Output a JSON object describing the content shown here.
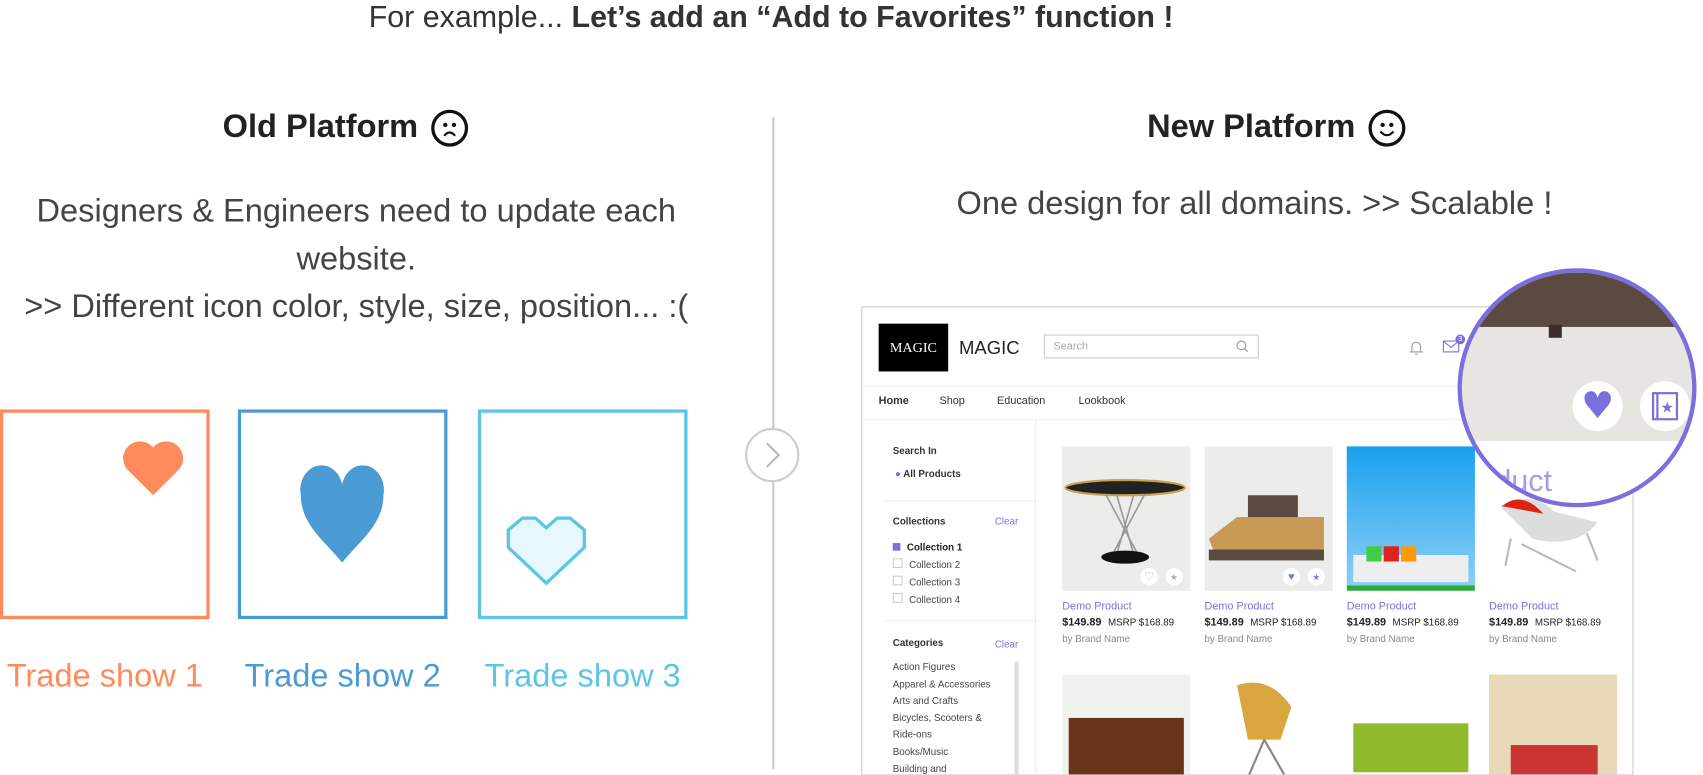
{
  "header": {
    "intro": "For example...",
    "headline": "Let’s add an “Add to Favorites” function !"
  },
  "old": {
    "title": "Old Platform",
    "icon": "sad-face-icon",
    "lines": [
      "Designers & Engineers need to update each",
      "website.",
      ">> Different icon color, style, size, position... :("
    ],
    "examples": [
      {
        "label": "Trade show 1",
        "color": "#ff8a5c",
        "icon": "solid-heart-icon"
      },
      {
        "label": "Trade show 2",
        "color": "#4a9ad4",
        "icon": "large-heart-icon"
      },
      {
        "label": "Trade show 3",
        "color": "#5bc5e6",
        "icon": "outline-pixel-heart-icon"
      }
    ]
  },
  "new": {
    "title": "New Platform",
    "icon": "smiley-face-icon",
    "subtitle": "One design for all domains. >> Scalable !",
    "accent": "#7b6fe0",
    "store": {
      "logo": "MAGIC",
      "brand": "MAGIC",
      "search_placeholder": "Search",
      "mail_badge": "3",
      "nav": [
        "Home",
        "Shop",
        "Education",
        "Lookbook"
      ],
      "sidebar": {
        "search_in": "Search In",
        "all_products": "All Products",
        "collections": "Collections",
        "clear": "Clear",
        "collection_items": [
          "Collection 1",
          "Collection 2",
          "Collection 3",
          "Collection 4"
        ],
        "categories": "Categories",
        "category_items": [
          "Action Figures",
          "Apparel & Accessories",
          "Arts and Crafts",
          "Bicycles, Scooters &",
          "Ride-ons",
          "Books/Music",
          "Building and"
        ]
      },
      "products": [
        {
          "name": "Demo Product",
          "price": "$149.89",
          "msrp": "MSRP $168.89",
          "brand": "by Brand Name",
          "favorited": false
        },
        {
          "name": "Demo Product",
          "price": "$149.89",
          "msrp": "MSRP $168.89",
          "brand": "by Brand Name",
          "favorited": true
        },
        {
          "name": "Demo Product",
          "price": "$149.89",
          "msrp": "MSRP $168.89",
          "brand": "by Brand Name",
          "favorited": false
        },
        {
          "name": "Demo Product",
          "price": "$149.89",
          "msrp": "MSRP $168.89",
          "brand": "by Brand Name",
          "favorited": false
        }
      ],
      "magnifier_text": "duct"
    }
  }
}
